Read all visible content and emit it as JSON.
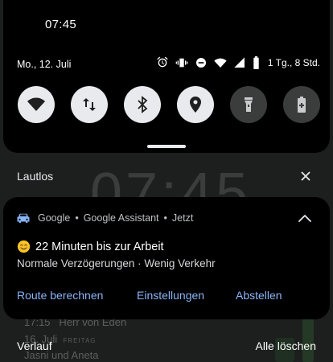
{
  "background": {
    "clock": "07:45",
    "entries": [
      {
        "time": "17:15",
        "label": "Herr von Eden"
      },
      {
        "day": "16. Juli",
        "weekday": "FREITAG",
        "label": "Jasni und Aneta"
      }
    ]
  },
  "status_bar": {
    "time": "07:45",
    "date": "Mo., 12. Juli",
    "battery_text": "1 Tg., 8 Std.",
    "icons": [
      "alarm-icon",
      "vibrate-icon",
      "do-not-disturb-icon",
      "wifi-icon",
      "signal-icon",
      "battery-icon"
    ]
  },
  "quick_tiles": [
    {
      "name": "wifi",
      "icon": "wifi-icon",
      "on": true
    },
    {
      "name": "mobile-data",
      "icon": "data-arrows-icon",
      "on": true
    },
    {
      "name": "bluetooth",
      "icon": "bluetooth-icon",
      "on": true
    },
    {
      "name": "location",
      "icon": "location-pin-icon",
      "on": true
    },
    {
      "name": "flashlight",
      "icon": "flashlight-icon",
      "on": false
    },
    {
      "name": "battery-saver",
      "icon": "battery-saver-icon",
      "on": false
    }
  ],
  "silent_section": {
    "label": "Lautlos"
  },
  "notification": {
    "app": "Google",
    "source": "Google Assistant",
    "time": "Jetzt",
    "dot": "•",
    "title": "22 Minuten bis zur Arbeit",
    "subtitle": "Normale Verzögerungen · Wenig Verkehr",
    "actions": [
      "Route berechnen",
      "Einstellungen",
      "Abstellen"
    ],
    "accent_color": "#8ab4f8"
  },
  "footer": {
    "history": "Verlauf",
    "clear_all": "Alle löschen"
  }
}
